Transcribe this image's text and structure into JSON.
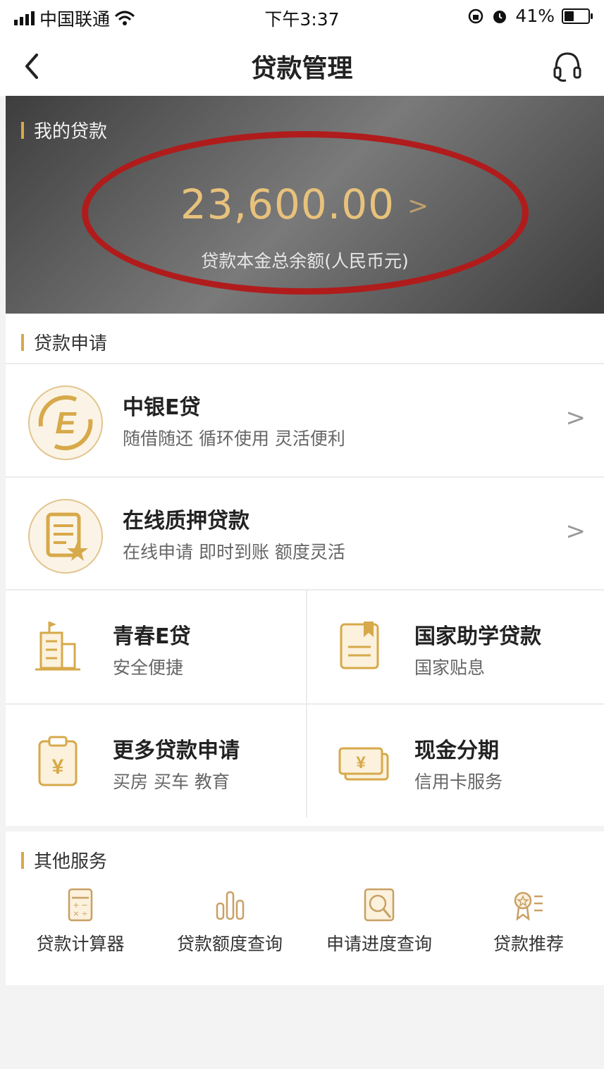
{
  "status_bar": {
    "carrier": "中国联通",
    "time": "下午3:37",
    "battery": "41%",
    "battery_level": 0.41
  },
  "nav": {
    "title": "贷款管理"
  },
  "my_loan": {
    "label": "我的贷款",
    "amount": "23,600.00",
    "caption": "贷款本金总余额(人民币元)"
  },
  "apply": {
    "label": "贷款申请",
    "rows": [
      {
        "title": "中银E贷",
        "subtitle": "随借随还 循环使用 灵活便利"
      },
      {
        "title": "在线质押贷款",
        "subtitle": "在线申请 即时到账 额度灵活"
      }
    ],
    "grid": [
      {
        "title": "青春E贷",
        "subtitle": "安全便捷"
      },
      {
        "title": "国家助学贷款",
        "subtitle": "国家贴息"
      },
      {
        "title": "更多贷款申请",
        "subtitle": "买房 买车 教育"
      },
      {
        "title": "现金分期",
        "subtitle": "信用卡服务"
      }
    ]
  },
  "other_services": {
    "label": "其他服务",
    "items": [
      {
        "label": "贷款计算器",
        "icon": "calculator-icon"
      },
      {
        "label": "贷款额度查询",
        "icon": "bar-chart-icon"
      },
      {
        "label": "申请进度查询",
        "icon": "magnifier-icon"
      },
      {
        "label": "贷款推荐",
        "icon": "award-list-icon"
      }
    ]
  },
  "colors": {
    "accent": "#d7a94a",
    "amount_gold": "#e8c27c",
    "annotation_red": "#b01c1c"
  }
}
